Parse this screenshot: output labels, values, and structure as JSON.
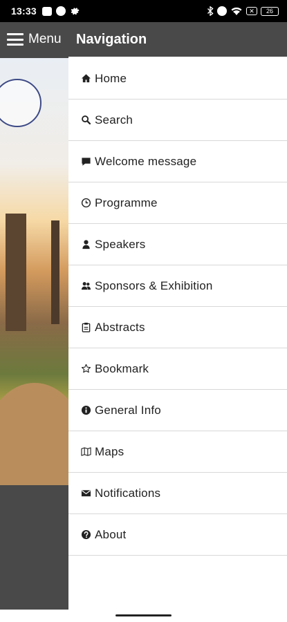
{
  "status_bar": {
    "time": "13:33",
    "battery": "26"
  },
  "menu_toggle": {
    "label": "Menu"
  },
  "navigation": {
    "title": "Navigation",
    "items": [
      {
        "label": "Home",
        "icon": "home-icon"
      },
      {
        "label": "Search",
        "icon": "search-icon"
      },
      {
        "label": "Welcome message",
        "icon": "message-icon"
      },
      {
        "label": "Programme",
        "icon": "clock-icon"
      },
      {
        "label": "Speakers",
        "icon": "user-icon"
      },
      {
        "label": "Sponsors & Exhibition",
        "icon": "users-icon"
      },
      {
        "label": "Abstracts",
        "icon": "clipboard-icon"
      },
      {
        "label": "Bookmark",
        "icon": "star-icon"
      },
      {
        "label": "General Info",
        "icon": "info-icon"
      },
      {
        "label": "Maps",
        "icon": "map-icon"
      },
      {
        "label": "Notifications",
        "icon": "envelope-icon"
      },
      {
        "label": "About",
        "icon": "question-icon"
      }
    ]
  },
  "colors": {
    "header_bg": "#494949",
    "status_bg": "#000000",
    "divider": "#d8d8d8"
  }
}
